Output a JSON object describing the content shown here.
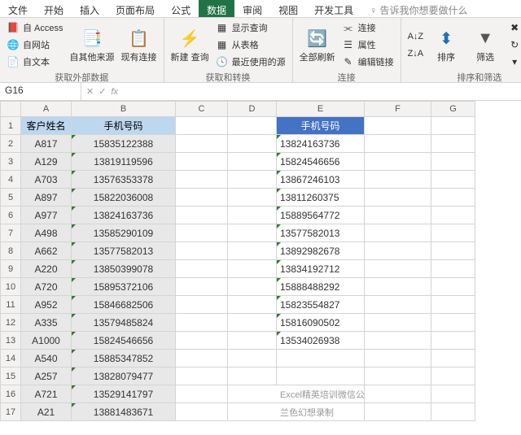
{
  "tabs": [
    "文件",
    "开始",
    "插入",
    "页面布局",
    "公式",
    "数据",
    "审阅",
    "视图",
    "开发工具"
  ],
  "tabActive": 5,
  "tabHint": "告诉我你想要做什么",
  "ribbon": {
    "g1": {
      "label": "获取外部数据",
      "access": "自 Access",
      "web": "自网站",
      "text": "自文本",
      "other": "自其他来源",
      "conn": "现有连接"
    },
    "g2": {
      "label": "获取和转换",
      "new": "新建\n查询",
      "show": "显示查询",
      "table": "从表格",
      "recent": "最近使用的源"
    },
    "g3": {
      "label": "连接",
      "refresh": "全部刷新",
      "conn": "连接",
      "prop": "属性",
      "edit": "编辑链接"
    },
    "g4": {
      "label": "排序和筛选",
      "az": "A↓Z",
      "za": "Z↓A",
      "sort": "排序",
      "filter": "筛选",
      "clear": "清除",
      "reapply": "重新应",
      "adv": "高级"
    }
  },
  "nameBox": "G16",
  "cols": [
    "A",
    "B",
    "C",
    "D",
    "E",
    "F",
    "G"
  ],
  "header": {
    "a": "客户姓名",
    "b": "手机号码",
    "e": "手机号码"
  },
  "rows": [
    {
      "a": "A817",
      "b": "15835122388",
      "e": "13824163736"
    },
    {
      "a": "A129",
      "b": "13819119596",
      "e": "15824546656"
    },
    {
      "a": "A703",
      "b": "13576353378",
      "e": "13867246103"
    },
    {
      "a": "A897",
      "b": "15822036008",
      "e": "13811260375"
    },
    {
      "a": "A977",
      "b": "13824163736",
      "e": "15889564772"
    },
    {
      "a": "A498",
      "b": "13585290109",
      "e": "13577582013"
    },
    {
      "a": "A662",
      "b": "13577582013",
      "e": "13892982678"
    },
    {
      "a": "A220",
      "b": "13850399078",
      "e": "13834192712"
    },
    {
      "a": "A720",
      "b": "15895372106",
      "e": "15888488292"
    },
    {
      "a": "A952",
      "b": "15846682506",
      "e": "15823554827"
    },
    {
      "a": "A335",
      "b": "13579485824",
      "e": "15816090502"
    },
    {
      "a": "A1000",
      "b": "15824546656",
      "e": "13534026938"
    },
    {
      "a": "A540",
      "b": "15885347852",
      "e": ""
    },
    {
      "a": "A257",
      "b": "13828079477",
      "e": ""
    },
    {
      "a": "A721",
      "b": "13529141797",
      "en": "Excel精英培训微信公众号出品"
    },
    {
      "a": "A21",
      "b": "13881483671",
      "en": "兰色幻想录制"
    }
  ]
}
